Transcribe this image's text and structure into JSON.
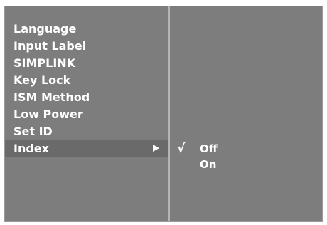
{
  "menu": {
    "items": [
      {
        "label": "Language"
      },
      {
        "label": "Input Label"
      },
      {
        "label": "SIMPLINK"
      },
      {
        "label": "Key Lock"
      },
      {
        "label": "ISM Method"
      },
      {
        "label": "Low Power"
      },
      {
        "label": "Set ID"
      },
      {
        "label": "Index",
        "selected": true,
        "has_submenu": true
      }
    ]
  },
  "submenu": {
    "options": [
      {
        "label": "Off",
        "checked": true,
        "check_mark": "√"
      },
      {
        "label": "On",
        "checked": false,
        "check_mark": ""
      }
    ]
  },
  "colors": {
    "background": "#7d7d7d",
    "selected_row": "#6a6a6a",
    "text": "#ffffff",
    "divider": "#b4b4b4"
  },
  "icons": {
    "submenu_arrow": "triangle-right-icon",
    "checked": "check-icon"
  }
}
